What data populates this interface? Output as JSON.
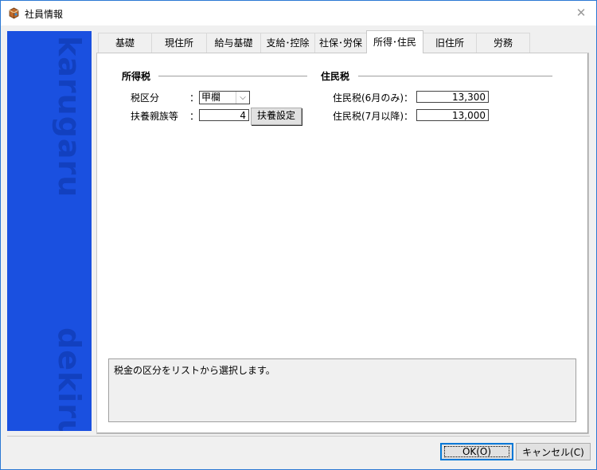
{
  "window": {
    "title": "社員情報",
    "accent_color": "#1a50e0",
    "border_color": "#2b78d4"
  },
  "sidebar": {
    "top_word": "karugaru",
    "bottom_word": "dekiru"
  },
  "tabs": [
    {
      "label": "基礎"
    },
    {
      "label": "現住所"
    },
    {
      "label": "給与基礎"
    },
    {
      "label": "支給･控除"
    },
    {
      "label": "社保･労保"
    },
    {
      "label": "所得･住民",
      "active": true
    },
    {
      "label": "旧住所"
    },
    {
      "label": "労務"
    }
  ],
  "income_tax": {
    "title": "所得税",
    "tax_class_label": "税区分",
    "tax_class_value": "甲欄",
    "dependents_label": "扶養親族等",
    "dependents_value": "4",
    "dependents_button": "扶養設定",
    "colon": "："
  },
  "resident_tax": {
    "title": "住民税",
    "june_label": "住民税(6月のみ)：",
    "june_value": "13,300",
    "july_label": "住民税(7月以降)：",
    "july_value": "13,000"
  },
  "info": {
    "message": "税金の区分をリストから選択します。"
  },
  "buttons": {
    "ok": "OK(O)",
    "cancel": "キャンセル(C)"
  }
}
